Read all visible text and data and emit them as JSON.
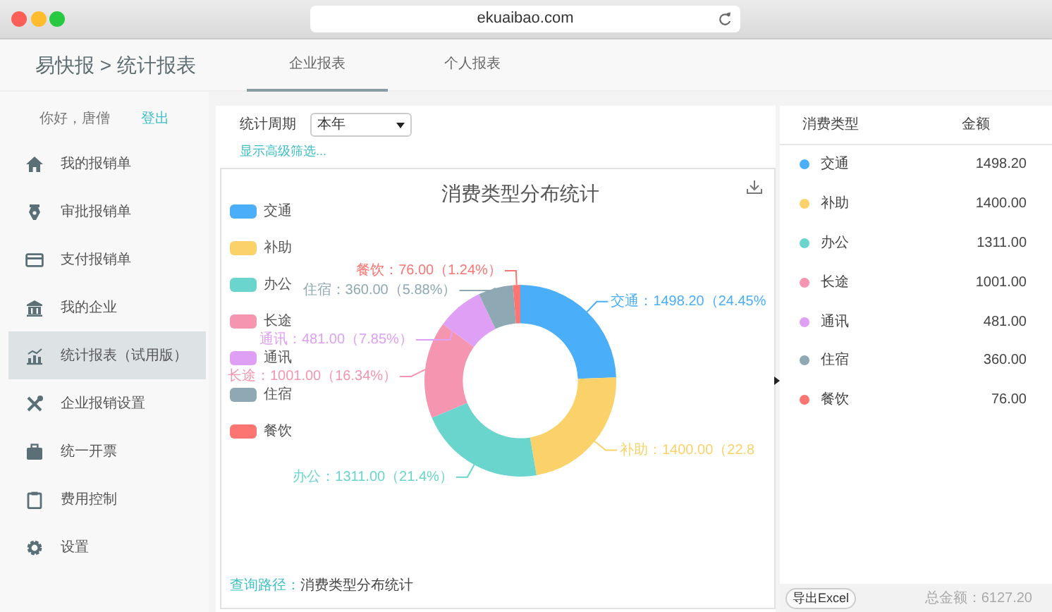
{
  "browser": {
    "url": "ekuaibao.com"
  },
  "header": {
    "breadcrumb": "易快报 > 统计报表",
    "tabs": [
      {
        "label": "企业报表",
        "selected": true
      },
      {
        "label": "个人报表",
        "selected": false
      }
    ]
  },
  "sidebar": {
    "greeting": "你好，唐僧",
    "logout": "登出",
    "items": [
      {
        "label": "我的报销单",
        "selected": false
      },
      {
        "label": "审批报销单",
        "selected": false
      },
      {
        "label": "支付报销单",
        "selected": false
      },
      {
        "label": "我的企业",
        "selected": false
      },
      {
        "label": "统计报表（试用版）",
        "selected": true
      },
      {
        "label": "企业报销设置",
        "selected": false
      },
      {
        "label": "统一开票",
        "selected": false
      },
      {
        "label": "费用控制",
        "selected": false
      },
      {
        "label": "设置",
        "selected": false
      }
    ]
  },
  "filters": {
    "period_label": "统计周期",
    "period_value": "本年",
    "advanced_link": "显示高级筛选..."
  },
  "chart": {
    "chart_data": {
      "type": "donut",
      "title": "消费类型分布统计",
      "categories": [
        "交通",
        "补助",
        "办公",
        "长途",
        "通讯",
        "住宿",
        "餐饮"
      ],
      "values": [
        1498.2,
        1400,
        1311,
        1001,
        481,
        360,
        76
      ],
      "colors": [
        "#4aaef8",
        "#fbd26a",
        "#6ad5cc",
        "#f595b0",
        "#df9ff5",
        "#8ea9b3",
        "#fb7573"
      ],
      "value_labels": [
        "交通：1498.20（24.45%",
        "补助：1400.00（22.8",
        "办公：1311.00（21.4%）",
        "长途：1001.00（16.34%）",
        "通讯：481.00（7.85%）",
        "住宿：360.00（5.88%）",
        "餐饮：76.00（1.24%）"
      ],
      "data_labels": true,
      "legend": true
    },
    "query_path_label": "查询路径：",
    "query_path": "消费类型分布统计"
  },
  "table": {
    "columns": [
      "消费类型",
      "金额"
    ],
    "rows": [
      {
        "type": "交通",
        "amount": "1498.20",
        "color": "#4aaef8"
      },
      {
        "type": "补助",
        "amount": "1400.00",
        "color": "#fbd26a"
      },
      {
        "type": "办公",
        "amount": "1311.00",
        "color": "#6ad5cc"
      },
      {
        "type": "长途",
        "amount": "1001.00",
        "color": "#f595b0"
      },
      {
        "type": "通讯",
        "amount": "481.00",
        "color": "#df9ff5"
      },
      {
        "type": "住宿",
        "amount": "360.00",
        "color": "#8ea9b3"
      },
      {
        "type": "餐饮",
        "amount": "76.00",
        "color": "#fb7573"
      }
    ]
  },
  "footer": {
    "export_button": "导出Excel",
    "total": "总金额：6127.20"
  }
}
